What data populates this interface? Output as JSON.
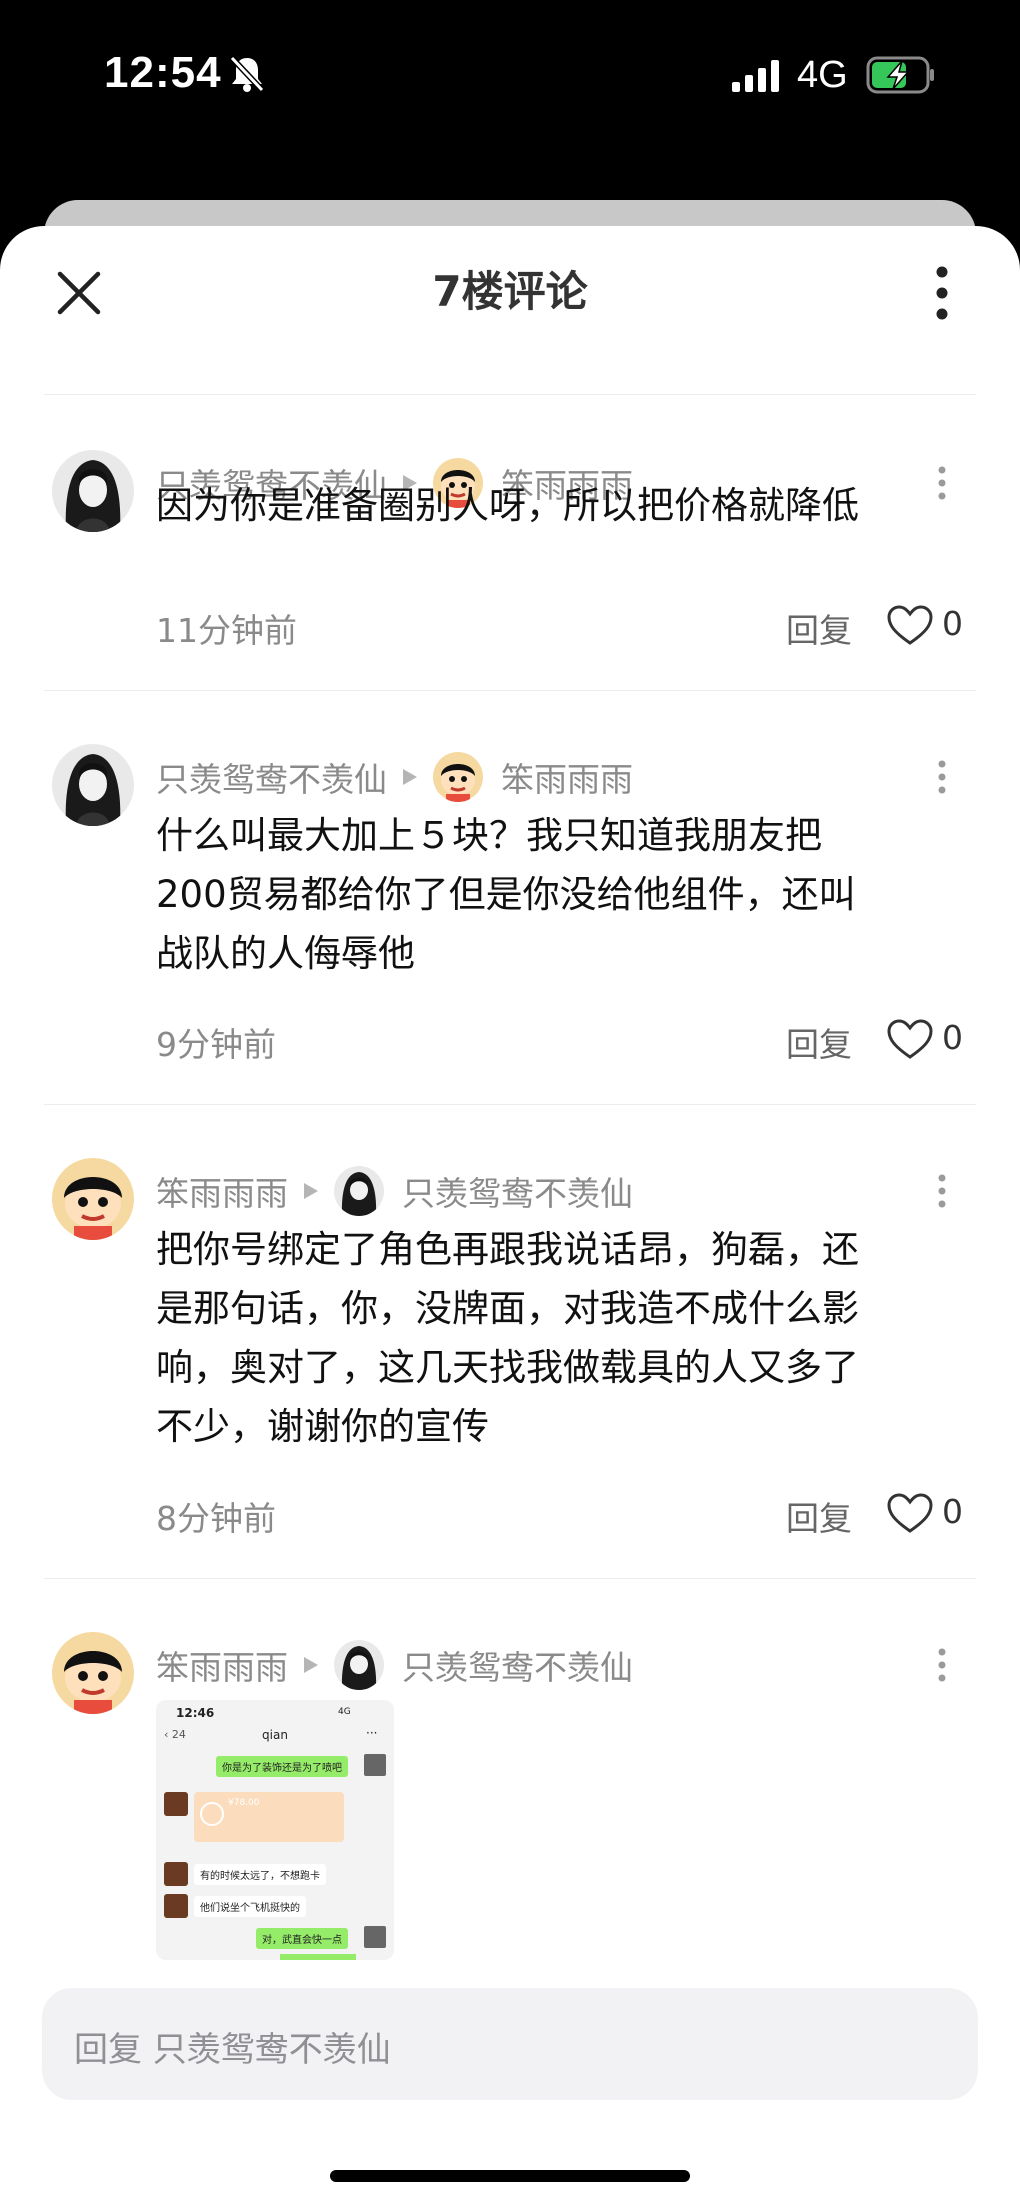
{
  "status_bar": {
    "time": "12:54",
    "network": "4G",
    "icons": [
      "bell-muted-icon",
      "signal-icon",
      "battery-charging-icon"
    ]
  },
  "header": {
    "title": "7楼评论",
    "close_icon": "close-icon",
    "more_icon": "more-vertical-icon"
  },
  "comments": [
    {
      "author": "只羡鸳鸯不羡仙",
      "reply_to": "笨雨雨雨",
      "text_lines": [
        "因为你是准备圈别人呀，所以把价格就降低"
      ],
      "time": "11分钟前",
      "reply_label": "回复",
      "likes": "0"
    },
    {
      "author": "只羡鸳鸯不羡仙",
      "reply_to": "笨雨雨雨",
      "text_lines": [
        "什么叫最大加上５块？我只知道我朋友把",
        "200贸易都给你了但是你没给他组件，还叫",
        "战队的人侮辱他"
      ],
      "time": "9分钟前",
      "reply_label": "回复",
      "likes": "0"
    },
    {
      "author": "笨雨雨雨",
      "reply_to": "只羡鸳鸯不羡仙",
      "text_lines": [
        "把你号绑定了角色再跟我说话昂，狗磊，还",
        "是那句话，你，没牌面，对我造不成什么影",
        "响，奥对了，这几天找我做载具的人又多了",
        "不少，谢谢你的宣传"
      ],
      "time": "8分钟前",
      "reply_label": "回复",
      "likes": "0"
    },
    {
      "author": "笨雨雨雨",
      "reply_to": "只羡鸳鸯不羡仙",
      "image": {
        "status_time": "12:46",
        "status_net": "4G",
        "back_count": "24",
        "chat_name": "qian",
        "messages": [
          {
            "side": "right",
            "text": "你是为了装饰还是为了喷吧"
          },
          {
            "side": "left",
            "text": "¥78.00"
          },
          {
            "side": "left",
            "text": "有的时候太远了，不想跑卡"
          },
          {
            "side": "left",
            "text": "他们说坐个飞机挺快的"
          },
          {
            "side": "right",
            "text": "对，武直会快一点"
          }
        ]
      }
    }
  ],
  "input": {
    "placeholder": "回复 只羡鸳鸯不羡仙"
  }
}
